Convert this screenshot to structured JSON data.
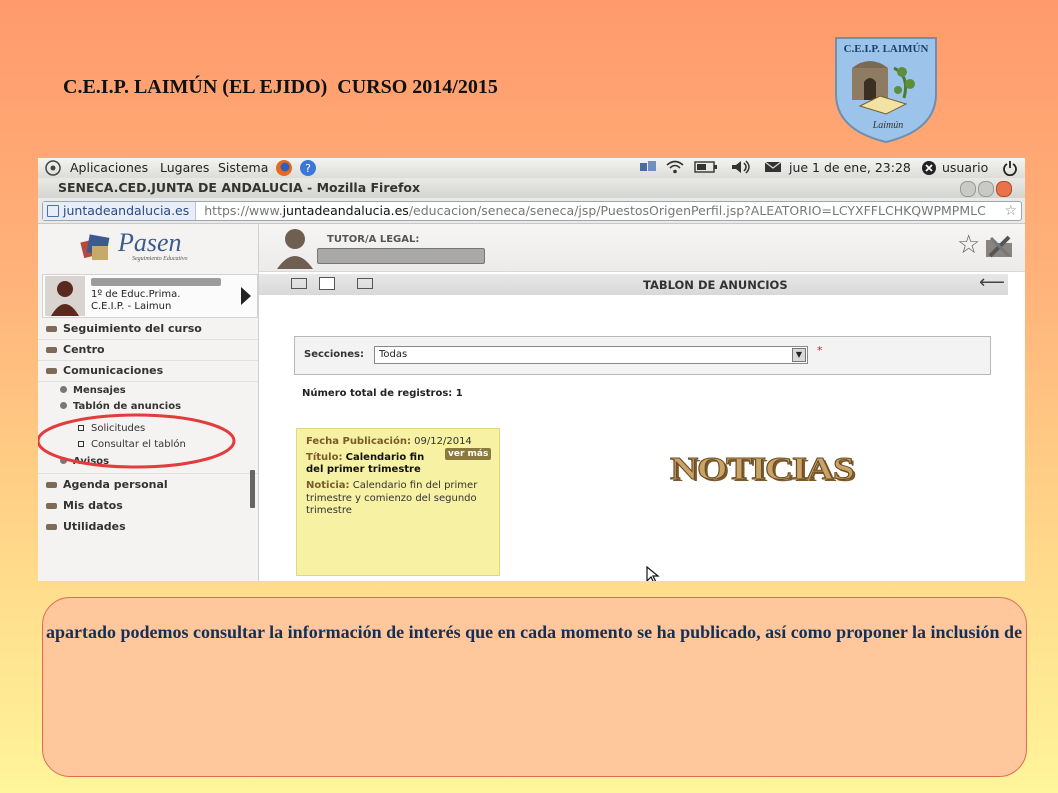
{
  "slide": {
    "title": "C.E.I.P. LAIMÚN (EL EJIDO)  CURSO 2014/2015",
    "logo_text": "C.E.I.P. LAIMÚN",
    "logo_sign": "Laimún",
    "callout_text": "En este apartado podemos consultar la información de interés que en cada momento se ha publicado, así como proponer la inclusión de información."
  },
  "os": {
    "menu": [
      "Aplicaciones",
      "Lugares",
      "Sistema"
    ],
    "datetime": "jue  1 de ene, 23:28",
    "user": "usuario"
  },
  "browser": {
    "window_title": "SENECA.CED.JUNTA DE ANDALUCIA - Mozilla Firefox",
    "site_identity": "juntadeandalucia.es",
    "url_prefix": "https://www.",
    "url_domain": "juntadeandalucia.es",
    "url_path": "/educacion/seneca/seneca/jsp/PuestosOrigenPerfil.jsp?ALEATORIO=LCYXFFLCHKQWPMPMLC"
  },
  "app": {
    "logo_name": "Pasen",
    "logo_tagline": "Seguimiento Educativo",
    "role_label": "TUTOR/A LEGAL:",
    "student": {
      "course": "1º de Educ.Prima.",
      "school": "C.E.I.P. - Laimun"
    },
    "menu": [
      "Seguimiento del curso",
      "Centro",
      "Comunicaciones",
      "Mensajes",
      "Tablón de anuncios",
      "Solicitudes",
      "Consultar el tablón",
      "Avisos",
      "Agenda personal",
      "Mis datos",
      "Utilidades"
    ],
    "panel_title": "TABLON DE ANUNCIOS",
    "filter_label": "Secciones:",
    "filter_value": "Todas",
    "required_mark": "*",
    "total_records": "Número total de registros: 1",
    "notice": {
      "date_label": "Fecha Publicación:",
      "date": "09/12/2014",
      "title_label": "Título:",
      "title": "Calendario fin del primer trimestre",
      "more_button": "ver más",
      "body_label": "Noticia:",
      "body": "Calendario fin del primer trimestre y comienzo del segundo trimestre"
    },
    "banner": "NOTICIAS"
  },
  "colors": {
    "highlight_circle": "#e23c3c",
    "notice_bg": "#f6f1a3",
    "callout_bg": "#ffc79b",
    "callout_text": "#123058"
  }
}
